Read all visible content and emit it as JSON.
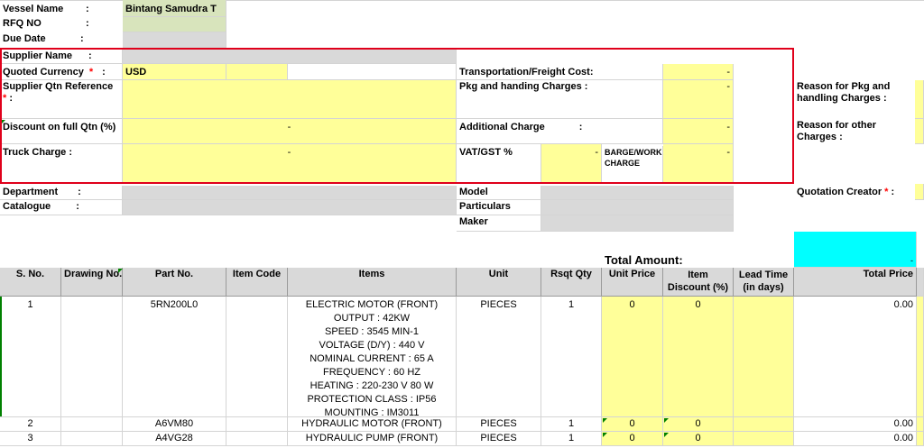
{
  "header": {
    "vessel_label": "Vessel Name",
    "vessel_value": "Bintang Samudra T",
    "rfq_label": "RFQ NO",
    "due_label": "Due Date",
    "colon": ":"
  },
  "supplier": {
    "name_label": "Supplier Name",
    "currency_label": "Quoted Currency",
    "currency_value": "USD",
    "qtn_ref_label": "Supplier Qtn Reference",
    "discount_label": "Discount on full Qtn  (%)",
    "discount_value": "-",
    "truck_label": "Truck Charge :",
    "truck_value": "-",
    "required_mark": "*"
  },
  "charges": {
    "transport_label": "Transportation/Freight Cost:",
    "transport_value": "-",
    "pkg_label": "Pkg and handing Charges  :",
    "pkg_value": "-",
    "additional_label": "Additional Charge",
    "additional_value": "-",
    "vat_label": "VAT/GST %",
    "vat_value": "-",
    "barge_label": "BARGE/WORKBOAT CHARGE",
    "barge_value": "-"
  },
  "reasons": {
    "pkg_reason_label": "Reason for Pkg and handling Charges :",
    "other_reason_label": "Reason for other Charges :",
    "creator_label": "Quotation Creator",
    "creator_colon": " :"
  },
  "details": {
    "department_label": "Department",
    "catalogue_label": "Catalogue",
    "model_label": "Model",
    "particulars_label": "Particulars",
    "maker_label": "Maker"
  },
  "total": {
    "label": "Total Amount:",
    "value": "-"
  },
  "columns": [
    "S. No.",
    "Drawing No.",
    "Part No.",
    "Item Code",
    "Items",
    "Unit",
    "Rsqt Qty",
    "Unit Price",
    "Item Discount (%)",
    "Lead Time (in days)",
    "Total Price"
  ],
  "rows": [
    {
      "sno": "1",
      "part_no": "5RN200L0",
      "items": [
        "ELECTRIC MOTOR (FRONT)",
        "OUTPUT : 42KW",
        "SPEED : 3545 MIN-1",
        "VOLTAGE (D/Y) : 440 V",
        "NOMINAL CURRENT : 65 A",
        "FREQUENCY : 60 HZ",
        "HEATING : 220-230 V 80 W",
        "PROTECTION CLASS : IP56",
        "MOUNTING : IM3011"
      ],
      "unit": "PIECES",
      "qty": "1",
      "unit_price": "0",
      "discount": "0",
      "total": "0.00"
    },
    {
      "sno": "2",
      "part_no": "A6VM80",
      "items": [
        "HYDRAULIC MOTOR (FRONT)"
      ],
      "unit": "PIECES",
      "qty": "1",
      "unit_price": "0",
      "discount": "0",
      "total": "0.00"
    },
    {
      "sno": "3",
      "part_no": "A4VG28",
      "items": [
        "HYDRAULIC PUMP (FRONT)"
      ],
      "unit": "PIECES",
      "qty": "1",
      "unit_price": "0",
      "discount": "0",
      "total": "0.00"
    }
  ]
}
